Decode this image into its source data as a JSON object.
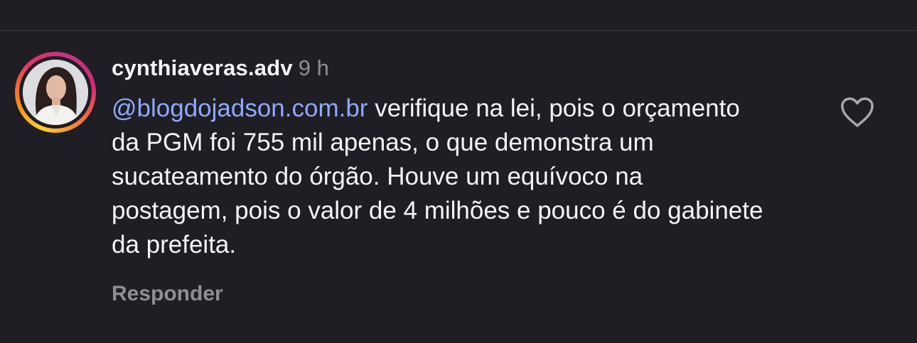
{
  "comment": {
    "username": "cynthiaveras.adv",
    "time": "9 h",
    "mention": "@blogdojadson.com.br",
    "text": " verifique na lei, pois o orçamento da PGM foi 755 mil apenas, o que demonstra um sucateamento do órgão. Houve um equívoco na postagem, pois o valor de 4 milhões e pouco é do gabinete da prefeita."
  },
  "actions": {
    "reply_label": "Responder",
    "like_icon": "heart-outline-icon"
  },
  "colors": {
    "background": "#1e1e24",
    "text": "#f5f5f7",
    "secondary_text": "#8e8e95",
    "mention": "#90a8ff"
  }
}
